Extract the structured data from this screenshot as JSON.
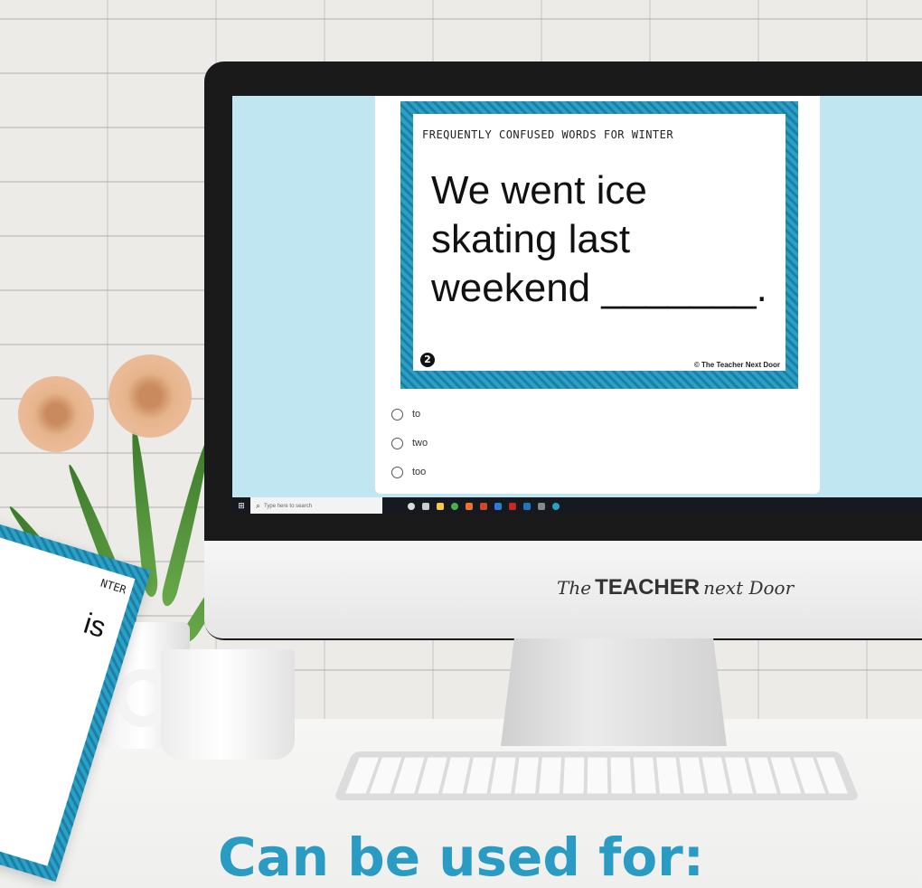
{
  "slide": {
    "title": "FREQUENTLY CONFUSED WORDS FOR WINTER",
    "sentence": "We went ice skating last weekend _______.",
    "number": "2",
    "copyright": "© The Teacher Next Door"
  },
  "options": [
    {
      "label": "to"
    },
    {
      "label": "two"
    },
    {
      "label": "too"
    }
  ],
  "taskbar": {
    "search_placeholder": "Type here to search"
  },
  "brand": {
    "part1": "The",
    "part2": "TEACHER",
    "part3": "next Door"
  },
  "paper": {
    "title": "NTER",
    "text": "is"
  },
  "caption": "Can be used for:",
  "colors": {
    "accent": "#2a9cc4",
    "screen_bg": "#bfe6f1",
    "stripe_dark": "#1d7fa3"
  }
}
